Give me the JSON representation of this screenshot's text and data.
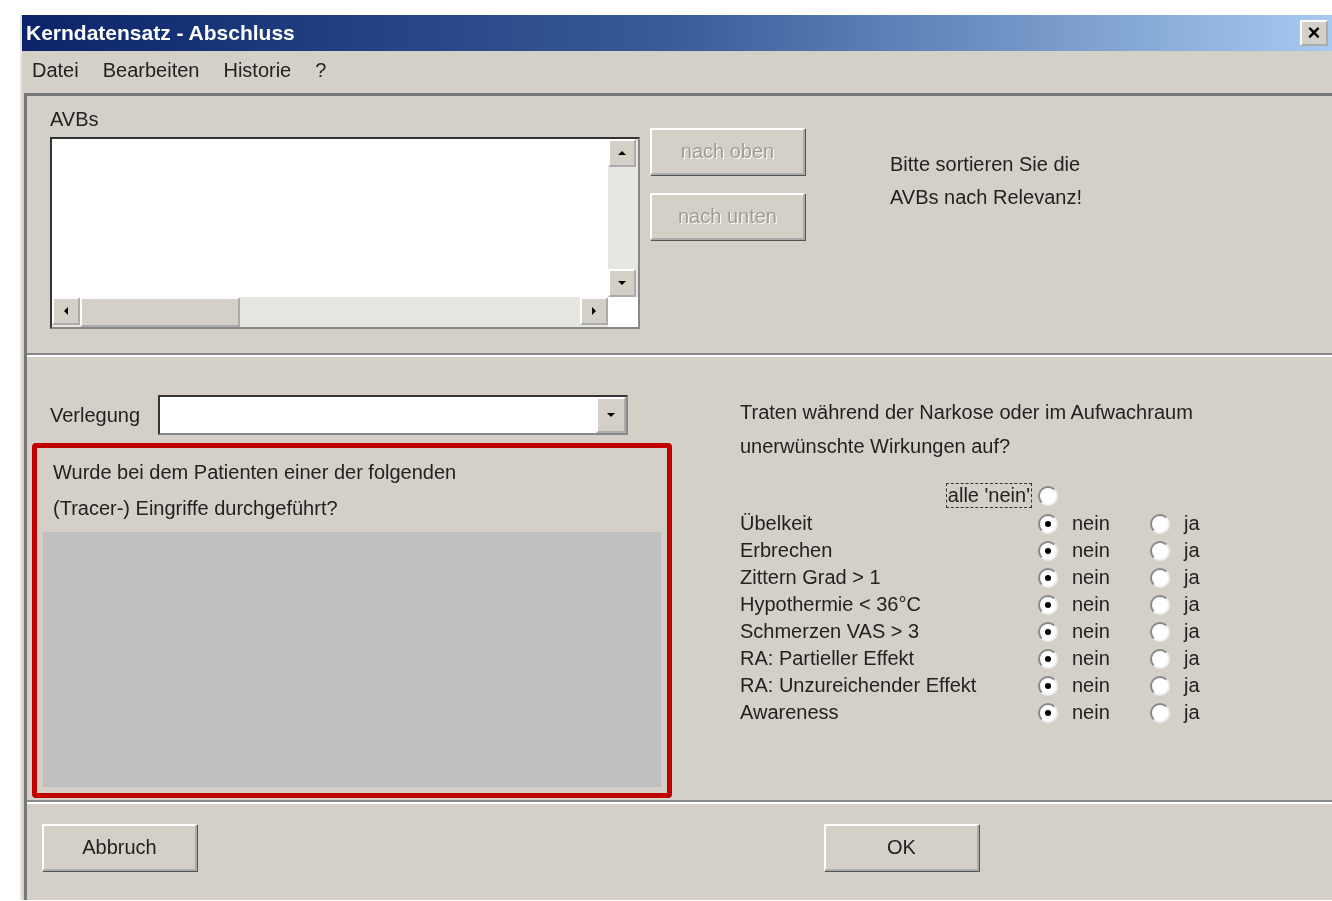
{
  "window": {
    "title": "Kerndatensatz - Abschluss",
    "close": "×"
  },
  "menu": [
    {
      "label": "Datei"
    },
    {
      "label": "Bearbeiten"
    },
    {
      "label": "Historie"
    },
    {
      "label": "?"
    }
  ],
  "avbs": {
    "label": "AVBs",
    "buttons": [
      {
        "label": "nach oben",
        "disabled": true
      },
      {
        "label": "nach unten",
        "disabled": true
      }
    ],
    "hint": "Bitte sortieren Sie die AVBs nach Relevanz!"
  },
  "verlegung": {
    "label": "Verlegung"
  },
  "tracer": {
    "question": "Wurde bei dem Patienten einer der folgenden (Tracer-) Eingriffe durchgeführt?",
    "highlighted": true
  },
  "effects": {
    "question": "Traten während der Narkose oder im Aufwachraum unerwünschte Wirkungen auf?",
    "all_no": {
      "label": "alle 'nein'",
      "selected": false
    },
    "rows": [
      {
        "label": "Übelkeit",
        "options": [
          {
            "label": "nein",
            "selected": true
          },
          {
            "label": "ja",
            "selected": false
          }
        ]
      },
      {
        "label": "Erbrechen",
        "options": [
          {
            "label": "nein",
            "selected": true
          },
          {
            "label": "ja",
            "selected": false
          }
        ]
      },
      {
        "label": "Zittern Grad > 1",
        "options": [
          {
            "label": "nein",
            "selected": true
          },
          {
            "label": "ja",
            "selected": false
          }
        ]
      },
      {
        "label": "Hypothermie < 36°C",
        "options": [
          {
            "label": "nein",
            "selected": true
          },
          {
            "label": "ja",
            "selected": false
          }
        ]
      },
      {
        "label": "Schmerzen VAS > 3",
        "options": [
          {
            "label": "nein",
            "selected": true
          },
          {
            "label": "ja",
            "selected": false
          }
        ]
      },
      {
        "label": "RA: Partieller Effekt",
        "options": [
          {
            "label": "nein",
            "selected": true
          },
          {
            "label": "ja",
            "selected": false
          }
        ]
      },
      {
        "label": "RA: Unzureichender Effekt",
        "options": [
          {
            "label": "nein",
            "selected": true
          },
          {
            "label": "ja",
            "selected": false
          }
        ]
      },
      {
        "label": "Awareness",
        "options": [
          {
            "label": "nein",
            "selected": true
          },
          {
            "label": "ja",
            "selected": false
          }
        ]
      }
    ]
  },
  "footer": {
    "buttons": [
      {
        "label": "Abbruch"
      },
      {
        "label": "OK"
      }
    ]
  }
}
